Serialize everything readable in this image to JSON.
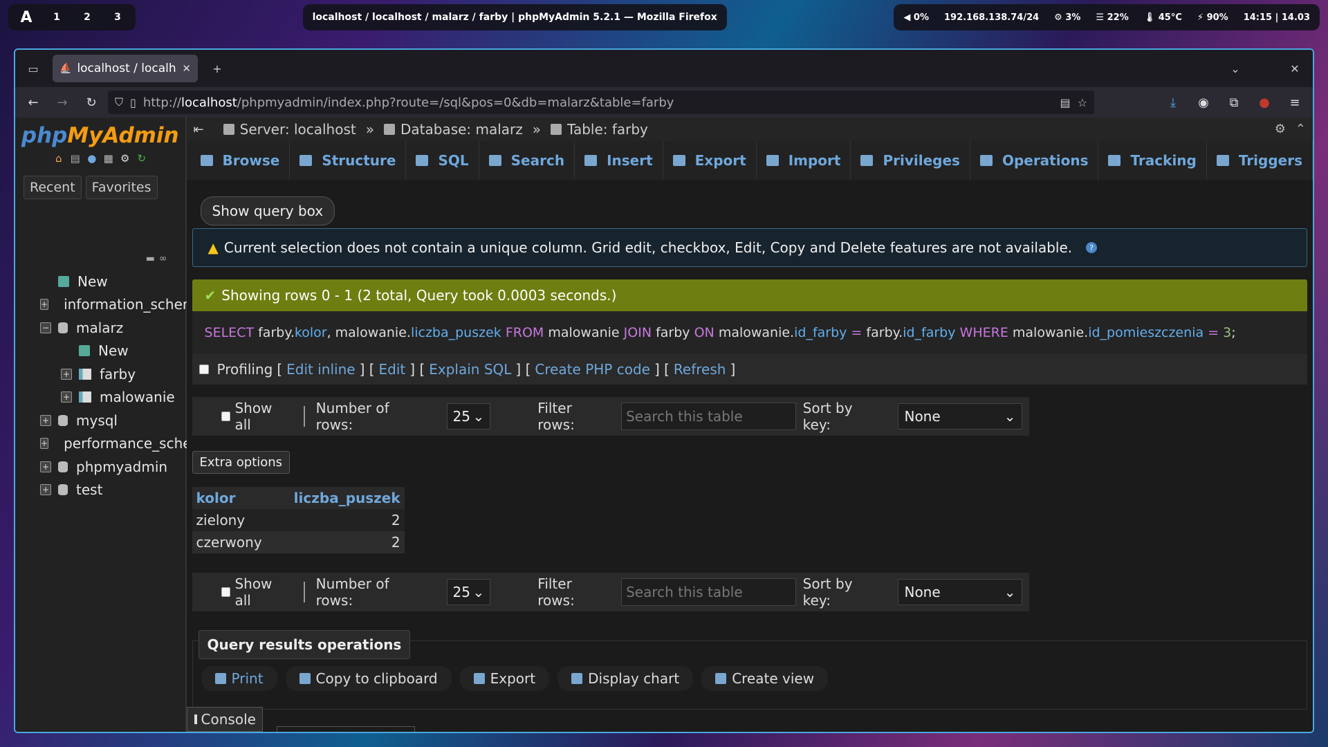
{
  "system_bar": {
    "logo": "A",
    "workspaces": [
      "1",
      "2",
      "3"
    ],
    "window_title": "localhost / localhost / malarz / farby | phpMyAdmin 5.2.1 — Mozilla Firefox",
    "status": {
      "volume": "0%",
      "network": "192.168.138.74/24",
      "cpu": "3%",
      "memory": "22%",
      "temp": "45°C",
      "battery": "90%",
      "clock": "14:15 | 14.03"
    }
  },
  "browser": {
    "tab_title": "localhost / localhost",
    "url_prefix": "http://",
    "url_host": "localhost",
    "url_path": "/phpmyadmin/index.php?route=/sql&pos=0&db=malarz&table=farby"
  },
  "sidebar": {
    "logo_php": "php",
    "logo_my": "MyAdmin",
    "tabs": [
      "Recent",
      "Favorites"
    ],
    "tree": [
      {
        "label": "New",
        "type": "new",
        "level": 0,
        "expander": ""
      },
      {
        "label": "information_schema",
        "type": "db",
        "level": 0,
        "expander": "+"
      },
      {
        "label": "malarz",
        "type": "db",
        "level": 0,
        "expander": "−"
      },
      {
        "label": "New",
        "type": "new",
        "level": 1,
        "expander": ""
      },
      {
        "label": "farby",
        "type": "table",
        "level": 1,
        "expander": "+"
      },
      {
        "label": "malowanie",
        "type": "table",
        "level": 1,
        "expander": "+"
      },
      {
        "label": "mysql",
        "type": "db",
        "level": 0,
        "expander": "+"
      },
      {
        "label": "performance_schema",
        "type": "db",
        "level": 0,
        "expander": "+"
      },
      {
        "label": "phpmyadmin",
        "type": "db",
        "level": 0,
        "expander": "+"
      },
      {
        "label": "test",
        "type": "db",
        "level": 0,
        "expander": "+"
      }
    ]
  },
  "breadcrumb": {
    "server": "Server: localhost",
    "database": "Database: malarz",
    "table": "Table: farby",
    "sep": "»"
  },
  "menu_tabs": [
    "Browse",
    "Structure",
    "SQL",
    "Search",
    "Insert",
    "Export",
    "Import",
    "Privileges",
    "Operations",
    "Tracking",
    "Triggers"
  ],
  "show_query_box": "Show query box",
  "notice": "Current selection does not contain a unique column. Grid edit, checkbox, Edit, Copy and Delete features are not available.",
  "success": "Showing rows 0 - 1 (2 total, Query took 0.0003 seconds.)",
  "sql": {
    "select": "SELECT",
    "t1": "farby.",
    "f1": "kolor",
    "c1": ", malowanie.",
    "f2": "liczba_puszek",
    "from": "FROM",
    "t2": "malowanie",
    "join": "JOIN",
    "t3": "farby",
    "on": "ON",
    "t4": "malowanie.",
    "f3": "id_farby",
    "eq1": "=",
    "t5": "farby.",
    "f4": "id_farby",
    "where": "WHERE",
    "t6": "malowanie.",
    "f5": "id_pomieszczenia",
    "eq2": "=",
    "n": "3",
    "end": ";"
  },
  "profiling": {
    "label": "Profiling",
    "links": [
      "Edit inline",
      "Edit",
      "Explain SQL",
      "Create PHP code",
      "Refresh"
    ]
  },
  "nav": {
    "show_all": "Show all",
    "num_rows_label": "Number of rows:",
    "num_rows_value": "25",
    "filter_label": "Filter rows:",
    "filter_placeholder": "Search this table",
    "sort_label": "Sort by key:",
    "sort_value": "None"
  },
  "extra_options": "Extra options",
  "results": {
    "columns": [
      "kolor",
      "liczba_puszek"
    ],
    "rows": [
      [
        "zielony",
        "2"
      ],
      [
        "czerwony",
        "2"
      ]
    ]
  },
  "query_ops": {
    "title": "Query results operations",
    "actions": [
      "Print",
      "Copy to clipboard",
      "Export",
      "Display chart",
      "Create view"
    ]
  },
  "console": "Console"
}
